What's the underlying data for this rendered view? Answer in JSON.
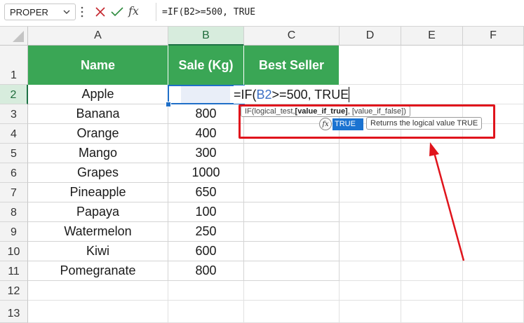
{
  "formula_bar": {
    "name_box": "PROPER",
    "fx_label": "fx",
    "formula": "=IF(B2>=500, TRUE"
  },
  "columns": [
    "A",
    "B",
    "C",
    "D",
    "E",
    "F"
  ],
  "rows": [
    "1",
    "2",
    "3",
    "4",
    "5",
    "6",
    "7",
    "8",
    "9",
    "10",
    "11",
    "12",
    "13"
  ],
  "table": {
    "headers": [
      "Name",
      "Sale (Kg)",
      "Best Seller"
    ],
    "names": [
      "Apple",
      "Banana",
      "Orange",
      "Mango",
      "Grapes",
      "Pineapple",
      "Papaya",
      "Watermelon",
      "Kiwi",
      "Pomegranate"
    ],
    "sales": [
      "",
      "800",
      "400",
      "300",
      "1000",
      "650",
      "100",
      "250",
      "600",
      "800"
    ]
  },
  "edit": {
    "prefix": "=IF(",
    "ref": "B2",
    "suffix": ">=500, TRUE"
  },
  "tooltip": {
    "open": "IF(logical_test, ",
    "bold": "[value_if_true]",
    "rest": ", [value_if_false])"
  },
  "autocomplete": {
    "icon": "fx",
    "item": "TRUE",
    "description": "Returns the logical value TRUE"
  },
  "colors": {
    "header_fill": "#3aa655",
    "highlight_box": "#e0141c",
    "active_cell": "#1f6fc8"
  }
}
